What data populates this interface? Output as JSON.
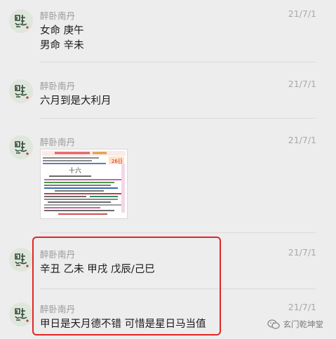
{
  "colors": {
    "background": "#ededed",
    "highlight": "#e02525",
    "avatar": "#dfe6dc"
  },
  "messages": [
    {
      "sender": "醉卧南丹",
      "time": "21/7/1",
      "lines": [
        "女命 庚午",
        "男命 辛未"
      ]
    },
    {
      "sender": "醉卧南丹",
      "time": "21/7/1",
      "lines": [
        "六月到是大利月"
      ]
    },
    {
      "sender": "醉卧南丹",
      "time": "21/7/1",
      "image": "calendar-screenshot",
      "image_text": {
        "big_day": "十六",
        "corner_number": "26日"
      }
    },
    {
      "sender": "醉卧南丹",
      "time": "21/7/1",
      "lines": [
        "辛丑  乙未  甲戌 戊辰/己巳"
      ]
    },
    {
      "sender": "醉卧南丹",
      "time": "21/7/1",
      "lines": [
        "甲日是天月德不错  可惜是星日马当值"
      ]
    }
  ],
  "watermark": {
    "icon": "wechat-official-icon",
    "text": "玄门乾坤堂"
  }
}
